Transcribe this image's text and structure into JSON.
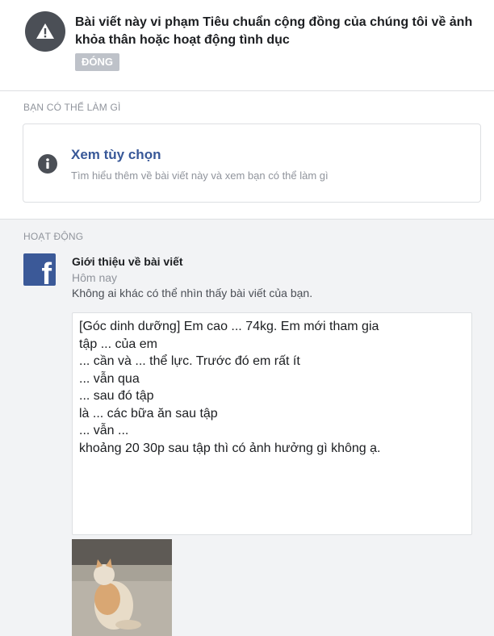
{
  "header": {
    "title": "Bài viết này vi phạm Tiêu chuẩn cộng đồng của chúng tôi về ảnh khỏa thân hoặc hoạt động tình dục",
    "status_badge": "ĐÓNG",
    "icon": "warning-icon"
  },
  "options_section": {
    "label": "BẠN CÓ THỂ LÀM GÌ",
    "card": {
      "title": "Xem tùy chọn",
      "description": "Tìm hiểu thêm về bài viết này và xem bạn có thể làm gì",
      "icon": "info-icon"
    }
  },
  "activity_section": {
    "label": "HOẠT ĐỘNG",
    "item": {
      "icon": "facebook-icon",
      "title": "Giới thiệu về bài viết",
      "time": "Hôm nay",
      "visibility": "Không ai khác có thể nhìn thấy bài viết của bạn.",
      "post_text": "[Góc dinh dưỡng] Em cao ... 74kg. Em mới tham gia\ntập ... của em\n... cần và ... thể lực. Trước đó em rất ít\n... vẫn qua\n... sau đó tập\nlà ... các bữa ăn sau tập\n... vẫn ...\nkhoảng 20 30p sau tập thì có ảnh hưởng gì không ạ.",
      "photo": "cat-photo"
    }
  },
  "colors": {
    "link": "#385898",
    "badge": "#bec2c9",
    "facebook_blue": "#3b5998",
    "icon_dark": "#4b4f56"
  }
}
